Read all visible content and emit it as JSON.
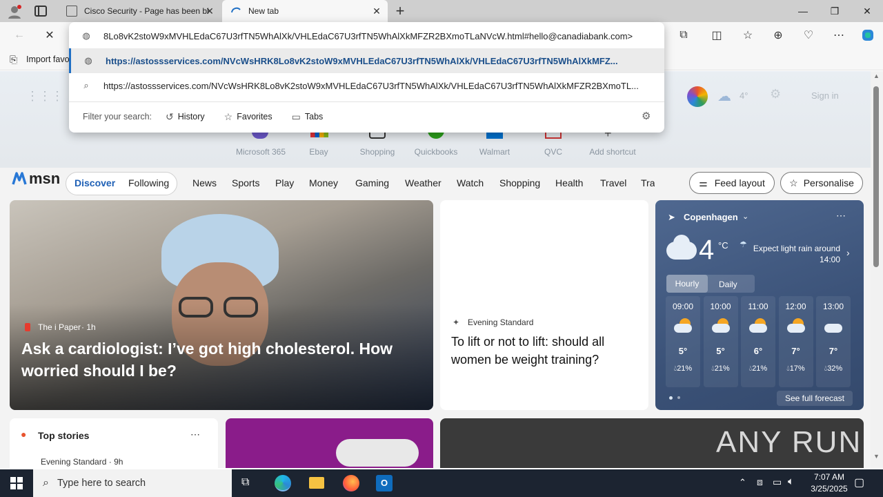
{
  "browser": {
    "tabs": [
      {
        "title": "Cisco Security - Page has been bl",
        "active": false
      },
      {
        "title": "New tab",
        "active": true
      }
    ],
    "address_value": "<8Lo8vK2stoW9xMVHLEdaC67U3rfTN5WhAlXk/VHLEdaC67U3rfTN5WhAlXkMFZR2BXmoTLaNVcW.html#hello@canadiabank.com",
    "suggestions": [
      "https://astossservices.com/NVcWsHRK8Lo8vK2stoW9xMVHLEdaC67U3rfTN5WhAlXk/VHLEdaC67U3rfTN5WhAlXkMFZ...",
      "https://astossservices.com/NVcWsHRK8Lo8vK2stoW9xMVHLEdaC67U3rfTN5WhAlXk/VHLEdaC67U3rfTN5WhAlXkMFZR2BXmoTL..."
    ],
    "filter_label": "Filter your search:",
    "filters": [
      "History",
      "Favorites",
      "Tabs"
    ],
    "favbar_import": "Import favo"
  },
  "shortcuts": [
    "Microsoft 365",
    "Ebay",
    "Shopping",
    "Quickbooks",
    "Walmart",
    "QVC",
    "Add shortcut"
  ],
  "header_right": {
    "temp": "4°",
    "signin": "Sign in"
  },
  "msn": {
    "logo": "msn",
    "tabs": [
      "Discover",
      "Following"
    ],
    "nav": [
      "News",
      "Sports",
      "Play",
      "Money",
      "Gaming",
      "Weather",
      "Watch",
      "Shopping",
      "Health",
      "Travel",
      "Tra"
    ],
    "feed_layout": "Feed layout",
    "personalise": "Personalise"
  },
  "hero": {
    "source": "The i Paper",
    "age": "· 1h",
    "title": "Ask a cardiologist: I’ve got high cholesterol. How worried should I be?"
  },
  "article2": {
    "source": "Evening Standard",
    "title": "To lift or not to lift: should all women be weight training?"
  },
  "weather": {
    "city": "Copenhagen",
    "temp": "4",
    "unit": "°C",
    "summary": "Expect light rain around 14:00",
    "tabs": [
      "Hourly",
      "Daily"
    ],
    "hours": [
      {
        "time": "09:00",
        "temp": "5°",
        "rain": "21%"
      },
      {
        "time": "10:00",
        "temp": "5°",
        "rain": "21%"
      },
      {
        "time": "11:00",
        "temp": "6°",
        "rain": "21%"
      },
      {
        "time": "12:00",
        "temp": "7°",
        "rain": "17%"
      },
      {
        "time": "13:00",
        "temp": "7°",
        "rain": "32%"
      }
    ],
    "see_full": "See full forecast"
  },
  "top_stories": {
    "title": "Top stories",
    "source": "Evening Standard · 9h"
  },
  "watermark": "ANY RUN",
  "taskbar": {
    "search_placeholder": "Type here to search",
    "time": "7:07 AM",
    "date": "3/25/2025"
  }
}
